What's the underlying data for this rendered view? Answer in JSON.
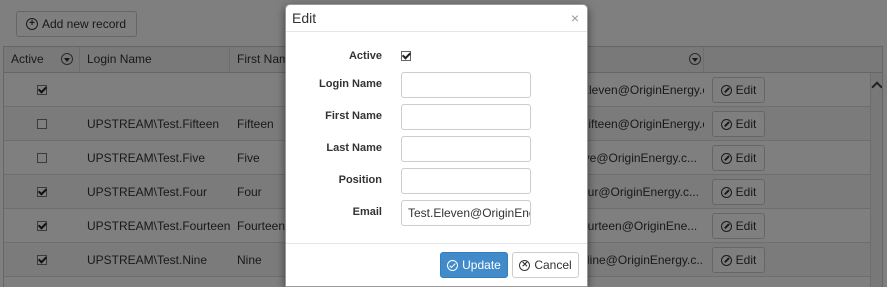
{
  "toolbar": {
    "add_label": "Add new record",
    "add_icon": "plus-circle-icon"
  },
  "grid": {
    "columns": [
      "Active",
      "Login Name",
      "First Name",
      "",
      ""
    ],
    "rows": [
      {
        "active": true,
        "login": "",
        "first": "",
        "email": "Eleven@OriginEnergy.c...",
        "edit": "Edit"
      },
      {
        "active": false,
        "login": "UPSTREAM\\Test.Fifteen",
        "first": "Fifteen",
        "email": "Fifteen@OriginEnergy.c...",
        "edit": "Edit"
      },
      {
        "active": false,
        "login": "UPSTREAM\\Test.Five",
        "first": "Five",
        "email": "ive@OriginEnergy.c...",
        "edit": "Edit"
      },
      {
        "active": true,
        "login": "UPSTREAM\\Test.Four",
        "first": "Four",
        "email": "our@OriginEnergy.c...",
        "edit": "Edit"
      },
      {
        "active": true,
        "login": "UPSTREAM\\Test.Fourteen",
        "first": "Fourteen",
        "email": "ourteen@OriginEne...",
        "edit": "Edit"
      },
      {
        "active": true,
        "login": "UPSTREAM\\Test.Nine",
        "first": "Nine",
        "email": "Nine@OriginEnergy.c...",
        "edit": "Edit"
      }
    ]
  },
  "modal": {
    "title": "Edit",
    "close": "×",
    "fields": {
      "active_label": "Active",
      "active_checked": true,
      "login_label": "Login Name",
      "login_value": "",
      "first_label": "First Name",
      "first_value": "",
      "last_label": "Last Name",
      "last_value": "",
      "position_label": "Position",
      "position_value": "",
      "email_label": "Email",
      "email_value": "Test.Eleven@OriginEnergy"
    },
    "update_label": "Update",
    "cancel_label": "Cancel"
  },
  "colors": {
    "primary": "#428bca",
    "overlay": "rgba(0,0,0,0.5)"
  }
}
